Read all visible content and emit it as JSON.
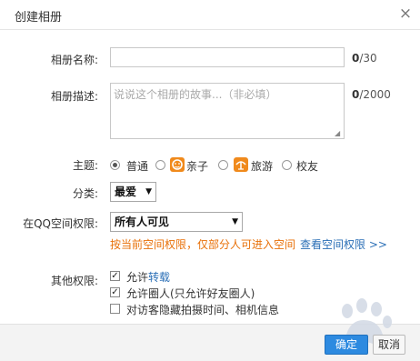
{
  "dialog": {
    "title": "创建相册",
    "close_glyph": "×"
  },
  "form": {
    "name_label": "相册名称:",
    "name_value": "",
    "name_count": "0",
    "name_max": "/30",
    "desc_label": "相册描述:",
    "desc_placeholder": "说说这个相册的故事...（非必填）",
    "desc_count": "0",
    "desc_max": "/2000",
    "theme_label": "主题:",
    "themes": [
      {
        "label": "普通",
        "checked": true,
        "icon": null
      },
      {
        "label": "亲子",
        "checked": false,
        "icon": "parent-child-icon"
      },
      {
        "label": "旅游",
        "checked": false,
        "icon": "travel-icon"
      },
      {
        "label": "校友",
        "checked": false,
        "icon": null
      }
    ],
    "category_label": "分类:",
    "category_value": "最爱",
    "permission_label": "在QQ空间权限:",
    "permission_value": "所有人可见",
    "permission_note": "按当前空间权限，仅部分人可进入空间",
    "permission_link": "查看空间权限 >>",
    "other_label": "其他权限:",
    "options": [
      {
        "prefix": "允许",
        "link": "转载",
        "suffix": "",
        "checked": true
      },
      {
        "prefix": "允许圈人(只允许好友圈人)",
        "link": "",
        "suffix": "",
        "checked": true
      },
      {
        "prefix": "对访客隐藏拍摄时间、相机信息",
        "link": "",
        "suffix": "",
        "checked": false
      }
    ]
  },
  "footer": {
    "ok_label": "确定",
    "cancel_label": "取消"
  },
  "colors": {
    "accent": "#2d8ae0",
    "warning": "#e8710a",
    "link": "#2b6fb6",
    "theme_icon": "#f08a1c"
  }
}
